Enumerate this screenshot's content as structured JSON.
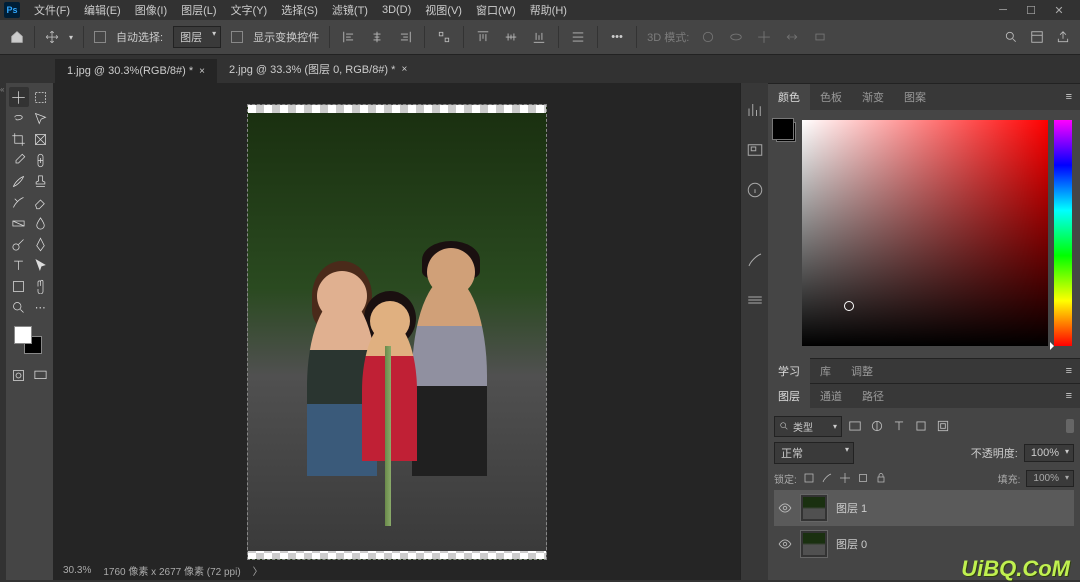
{
  "menu": {
    "items": [
      "文件(F)",
      "编辑(E)",
      "图像(I)",
      "图层(L)",
      "文字(Y)",
      "选择(S)",
      "滤镜(T)",
      "3D(D)",
      "视图(V)",
      "窗口(W)",
      "帮助(H)"
    ]
  },
  "options": {
    "auto_select_label": "自动选择:",
    "auto_select_target": "图层",
    "show_transform_label": "显示变换控件",
    "mode_3d_label": "3D 模式:"
  },
  "tabs": [
    {
      "label": "1.jpg @ 30.3%(RGB/8#) *",
      "active": true
    },
    {
      "label": "2.jpg @ 33.3% (图层 0, RGB/8#) *",
      "active": false
    }
  ],
  "status": {
    "zoom": "30.3%",
    "dimensions": "1760 像素 x 2677 像素 (72 ppi)"
  },
  "color_panel": {
    "tabs": [
      "颜色",
      "色板",
      "渐变",
      "图案"
    ]
  },
  "mid_panel": {
    "tabs": [
      "学习",
      "库",
      "调整"
    ]
  },
  "layers_panel": {
    "tabs": [
      "图层",
      "通道",
      "路径"
    ],
    "filter_label": "类型",
    "blend_mode": "正常",
    "opacity_label": "不透明度:",
    "opacity_value": "100%",
    "lock_label": "锁定:",
    "fill_label": "填充:",
    "fill_value": "100%",
    "layers": [
      {
        "name": "图层 1",
        "visible": true,
        "selected": true
      },
      {
        "name": "图层 0",
        "visible": true,
        "selected": false
      }
    ]
  },
  "watermark": "UiBQ.CoM"
}
